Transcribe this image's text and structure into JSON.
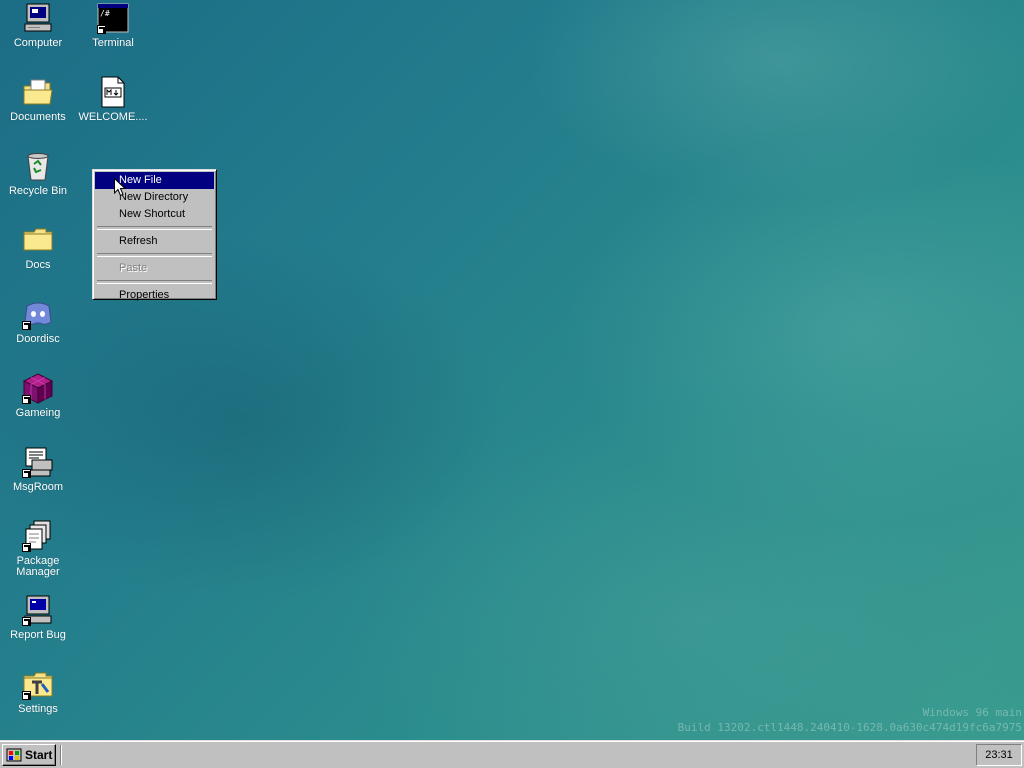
{
  "desktop": {
    "icons": [
      {
        "label": "Computer",
        "icon": "computer-icon"
      },
      {
        "label": "Terminal",
        "icon": "terminal-icon"
      },
      {
        "label": "Documents",
        "icon": "documents-folder-icon"
      },
      {
        "label": "WELCOME....",
        "icon": "markdown-file-icon"
      },
      {
        "label": "Recycle Bin",
        "icon": "recycle-bin-icon"
      },
      {
        "label": "Docs",
        "icon": "folder-icon"
      },
      {
        "label": "Doordisc",
        "icon": "doordisc-icon"
      },
      {
        "label": "Gameing",
        "icon": "game-cube-icon"
      },
      {
        "label": "MsgRoom",
        "icon": "msgroom-icon"
      },
      {
        "label": "Package Manager",
        "icon": "package-manager-icon"
      },
      {
        "label": "Report Bug",
        "icon": "report-bug-icon"
      },
      {
        "label": "Settings",
        "icon": "settings-icon"
      }
    ],
    "terminal_glyph": "/#"
  },
  "context_menu": {
    "items": [
      {
        "label": "New File",
        "state": "selected"
      },
      {
        "label": "New Directory",
        "state": "normal"
      },
      {
        "label": "New Shortcut",
        "state": "normal"
      },
      {
        "label": "Refresh",
        "state": "normal"
      },
      {
        "label": "Paste",
        "state": "disabled"
      },
      {
        "label": "Properties",
        "state": "normal"
      }
    ]
  },
  "watermark": {
    "line1": "Windows 96 main",
    "line2": "Build 13202.ctl1448.240410-1628.0a630c474d19fc6a7975"
  },
  "taskbar": {
    "start_label": "Start",
    "clock": "23:31"
  },
  "colors": {
    "menu_highlight": "#000080",
    "taskbar": "#c0c0c0"
  }
}
